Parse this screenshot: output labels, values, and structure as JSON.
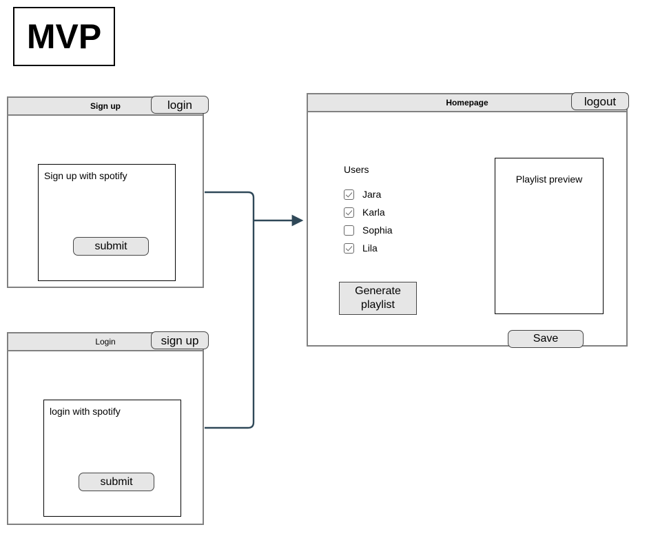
{
  "logo": {
    "text": "MVP"
  },
  "windows": {
    "signup": {
      "title": "Sign up",
      "header_button": "login",
      "panel_label": "Sign up with spotify",
      "submit_label": "submit"
    },
    "login": {
      "title": "Login",
      "header_button": "sign up",
      "panel_label": "login with spotify",
      "submit_label": "submit"
    },
    "homepage": {
      "title": "Homepage",
      "header_button": "logout",
      "users_heading": "Users",
      "users": [
        {
          "name": "Jara",
          "checked": true
        },
        {
          "name": "Karla",
          "checked": true
        },
        {
          "name": "Sophia",
          "checked": false
        },
        {
          "name": "Lila",
          "checked": true
        }
      ],
      "generate_button": "Generate playlist",
      "preview_label": "Playlist preview",
      "save_button": "Save"
    }
  },
  "colors": {
    "titlebar_fill": "#e6e6e6",
    "frame_border": "#808080",
    "panel_border": "#000000",
    "button_fill": "#e6e6e6",
    "connector": "#2f4858",
    "checkbox_border": "#666666"
  }
}
